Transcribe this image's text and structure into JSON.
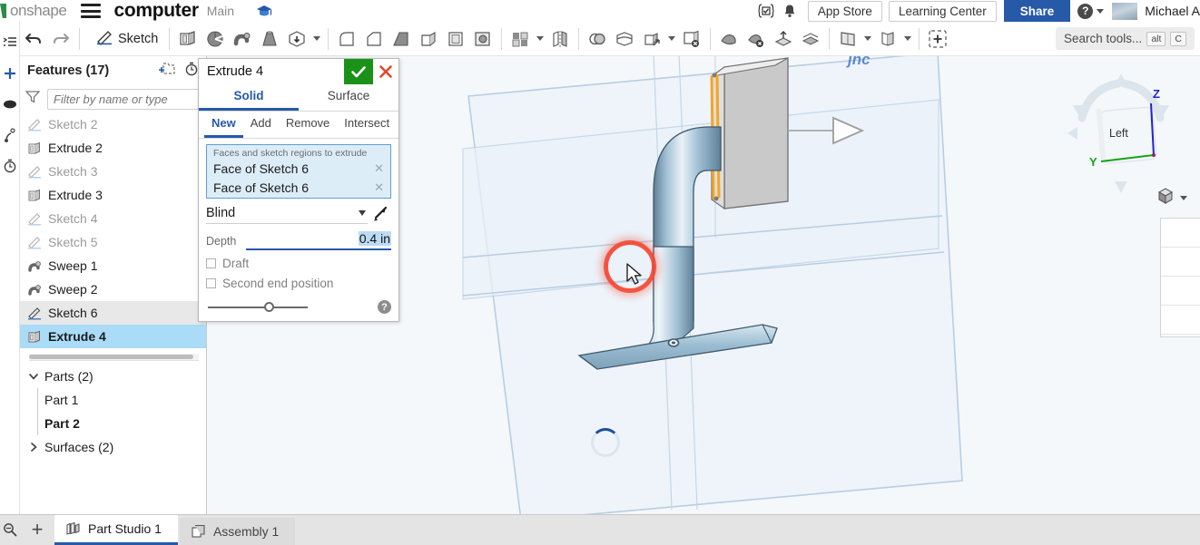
{
  "header": {
    "logo_text": "onshape",
    "logo_icon": "onshape-logo-icon",
    "menu_icon": "hamburger-menu-icon",
    "document_name": "computer",
    "branch_name": "Main",
    "graduation_icon": "graduation-cap-icon",
    "tasks_icon": "tasks-checkbox-icon",
    "notifications_icon": "bell-notification-icon",
    "notification_count": "",
    "app_store_label": "App Store",
    "learning_center_label": "Learning Center",
    "share_label": "Share",
    "help_icon": "question-mark-help-icon",
    "help_caret_icon": "chevron-down-icon",
    "avatar_icon": "user-avatar",
    "user_name": "Michael A"
  },
  "toolbar": {
    "undo_icon": "undo-arrow-icon",
    "redo_icon": "redo-arrow-icon",
    "sketch_label": "Sketch",
    "sketch_icon": "sketch-pencil-icon",
    "tools": [
      {
        "name": "extrude-icon",
        "title": "Extrude"
      },
      {
        "name": "revolve-icon",
        "title": "Revolve"
      },
      {
        "name": "sweep-icon",
        "title": "Sweep"
      },
      {
        "name": "loft-icon",
        "title": "Loft"
      },
      {
        "name": "thicken-icon",
        "title": "Thicken"
      },
      {
        "name": "fillet-icon",
        "title": "Fillet"
      },
      {
        "name": "chamfer-icon",
        "title": "Chamfer"
      },
      {
        "name": "draft-icon",
        "title": "Draft"
      },
      {
        "name": "rib-icon",
        "title": "Rib"
      },
      {
        "name": "shell-icon",
        "title": "Shell"
      },
      {
        "name": "hole-icon",
        "title": "Hole"
      },
      {
        "name": "linear-pattern-icon",
        "title": "Linear pattern"
      },
      {
        "name": "mirror-icon",
        "title": "Mirror"
      },
      {
        "name": "boolean-icon",
        "title": "Boolean"
      },
      {
        "name": "split-icon",
        "title": "Split"
      },
      {
        "name": "transform-icon",
        "title": "Transform"
      },
      {
        "name": "delete-part-icon",
        "title": "Delete part"
      },
      {
        "name": "fill-surface-icon",
        "title": "Fill"
      },
      {
        "name": "delete-face-icon",
        "title": "Delete face"
      },
      {
        "name": "move-face-icon",
        "title": "Move face"
      },
      {
        "name": "offset-surface-icon",
        "title": "Offset surface"
      },
      {
        "name": "plane-icon",
        "title": "Plane"
      },
      {
        "name": "sheet-metal-icon",
        "title": "Sheet metal"
      },
      {
        "name": "insert-feature-icon",
        "title": "Insert"
      }
    ],
    "search_placeholder": "Search tools...",
    "search_icon": "search-tools-icon",
    "shortcut_alt": "alt",
    "shortcut_key": "C"
  },
  "rail": {
    "items": [
      {
        "name": "feature-list-icon"
      },
      {
        "name": "add-plus-icon"
      },
      {
        "name": "ellipse-shape-icon"
      },
      {
        "name": "sketch-point-icon"
      },
      {
        "name": "timer-icon"
      }
    ]
  },
  "feature_tree": {
    "title": "Features (17)",
    "new_folder_icon": "new-folder-icon",
    "rollback_icon": "rollback-timer-icon",
    "filter_icon": "filter-funnel-icon",
    "filter_placeholder": "Filter by name or type",
    "features": [
      {
        "label": "Sketch 2",
        "icon": "sketch-icon",
        "state": "dim"
      },
      {
        "label": "Extrude 2",
        "icon": "extrude-icon",
        "state": "normal"
      },
      {
        "label": "Sketch 3",
        "icon": "sketch-icon",
        "state": "dim"
      },
      {
        "label": "Extrude 3",
        "icon": "extrude-icon",
        "state": "normal"
      },
      {
        "label": "Sketch 4",
        "icon": "sketch-icon",
        "state": "dim"
      },
      {
        "label": "Sketch 5",
        "icon": "sketch-icon",
        "state": "dim"
      },
      {
        "label": "Sweep 1",
        "icon": "sweep-icon",
        "state": "normal"
      },
      {
        "label": "Sweep 2",
        "icon": "sweep-icon",
        "state": "normal"
      },
      {
        "label": "Sketch 6",
        "icon": "sketch-icon",
        "state": "sel-light"
      },
      {
        "label": "Extrude 4",
        "icon": "extrude-icon",
        "state": "sel-blue"
      }
    ],
    "parts": {
      "label": "Parts (2)",
      "expanded_icon": "chevron-down-icon",
      "children": [
        {
          "label": "Part 1",
          "bold": false
        },
        {
          "label": "Part 2",
          "bold": true
        }
      ]
    },
    "surfaces": {
      "label": "Surfaces (2)",
      "collapsed_icon": "chevron-right-icon"
    }
  },
  "dialog": {
    "title": "Extrude 4",
    "confirm_icon": "checkmark-icon",
    "cancel_icon": "close-x-icon",
    "tabs": [
      {
        "label": "Solid",
        "active": true
      },
      {
        "label": "Surface",
        "active": false
      }
    ],
    "subtabs": [
      {
        "label": "New",
        "active": true
      },
      {
        "label": "Add",
        "active": false
      },
      {
        "label": "Remove",
        "active": false
      },
      {
        "label": "Intersect",
        "active": false
      }
    ],
    "selection_label": "Faces and sketch regions to extrude",
    "selections": [
      {
        "label": "Face of Sketch 6",
        "remove_icon": "remove-x-icon"
      },
      {
        "label": "Face of Sketch 6",
        "remove_icon": "remove-x-icon"
      }
    ],
    "end_condition": "Blind",
    "end_condition_caret": "chevron-down-icon",
    "flip_icon": "flip-direction-icon",
    "depth_label": "Depth",
    "depth_value": "0.4 in",
    "draft_label": "Draft",
    "draft_checked": false,
    "second_end_label": "Second end position",
    "second_end_checked": false,
    "help_icon": "question-mark-help-icon",
    "accent_color": "#2659a8",
    "confirm_color": "#1a9218",
    "cancel_color": "#e04a27",
    "selection_bg": "#dcedf8"
  },
  "viewport": {
    "ghost_label": "jnc",
    "view_cube": {
      "face_label": "Left",
      "axis_y": "Y",
      "axis_z": "Z",
      "axis_y_color": "#16a316",
      "axis_z_color": "#2222cc",
      "rotate_left_icon": "rotate-left-arrow-icon",
      "rotate_right_icon": "rotate-right-arrow-icon",
      "arrow_up_icon": "view-arrow-up-icon",
      "arrow_down_icon": "view-arrow-down-icon",
      "arrow_left_icon": "view-arrow-left-icon"
    },
    "display_mode_icon": "display-style-cube-icon",
    "display_mode_caret": "chevron-down-icon",
    "spinner_icon": "loading-spinner",
    "cursor_icon": "mouse-cursor-arrow",
    "direction_handle_icon": "extrude-direction-arrow-handle",
    "highlight_color": "#f4442e",
    "sketch_highlight_color": "#f5a623",
    "part_color": "#a8c4d8"
  },
  "tabbar": {
    "zoom_icon": "zoom-fit-icon",
    "add_tab_icon": "add-tab-plus-icon",
    "tabs": [
      {
        "label": "Part Studio 1",
        "icon": "part-studio-icon",
        "active": true
      },
      {
        "label": "Assembly 1",
        "icon": "assembly-icon",
        "active": false
      }
    ]
  }
}
